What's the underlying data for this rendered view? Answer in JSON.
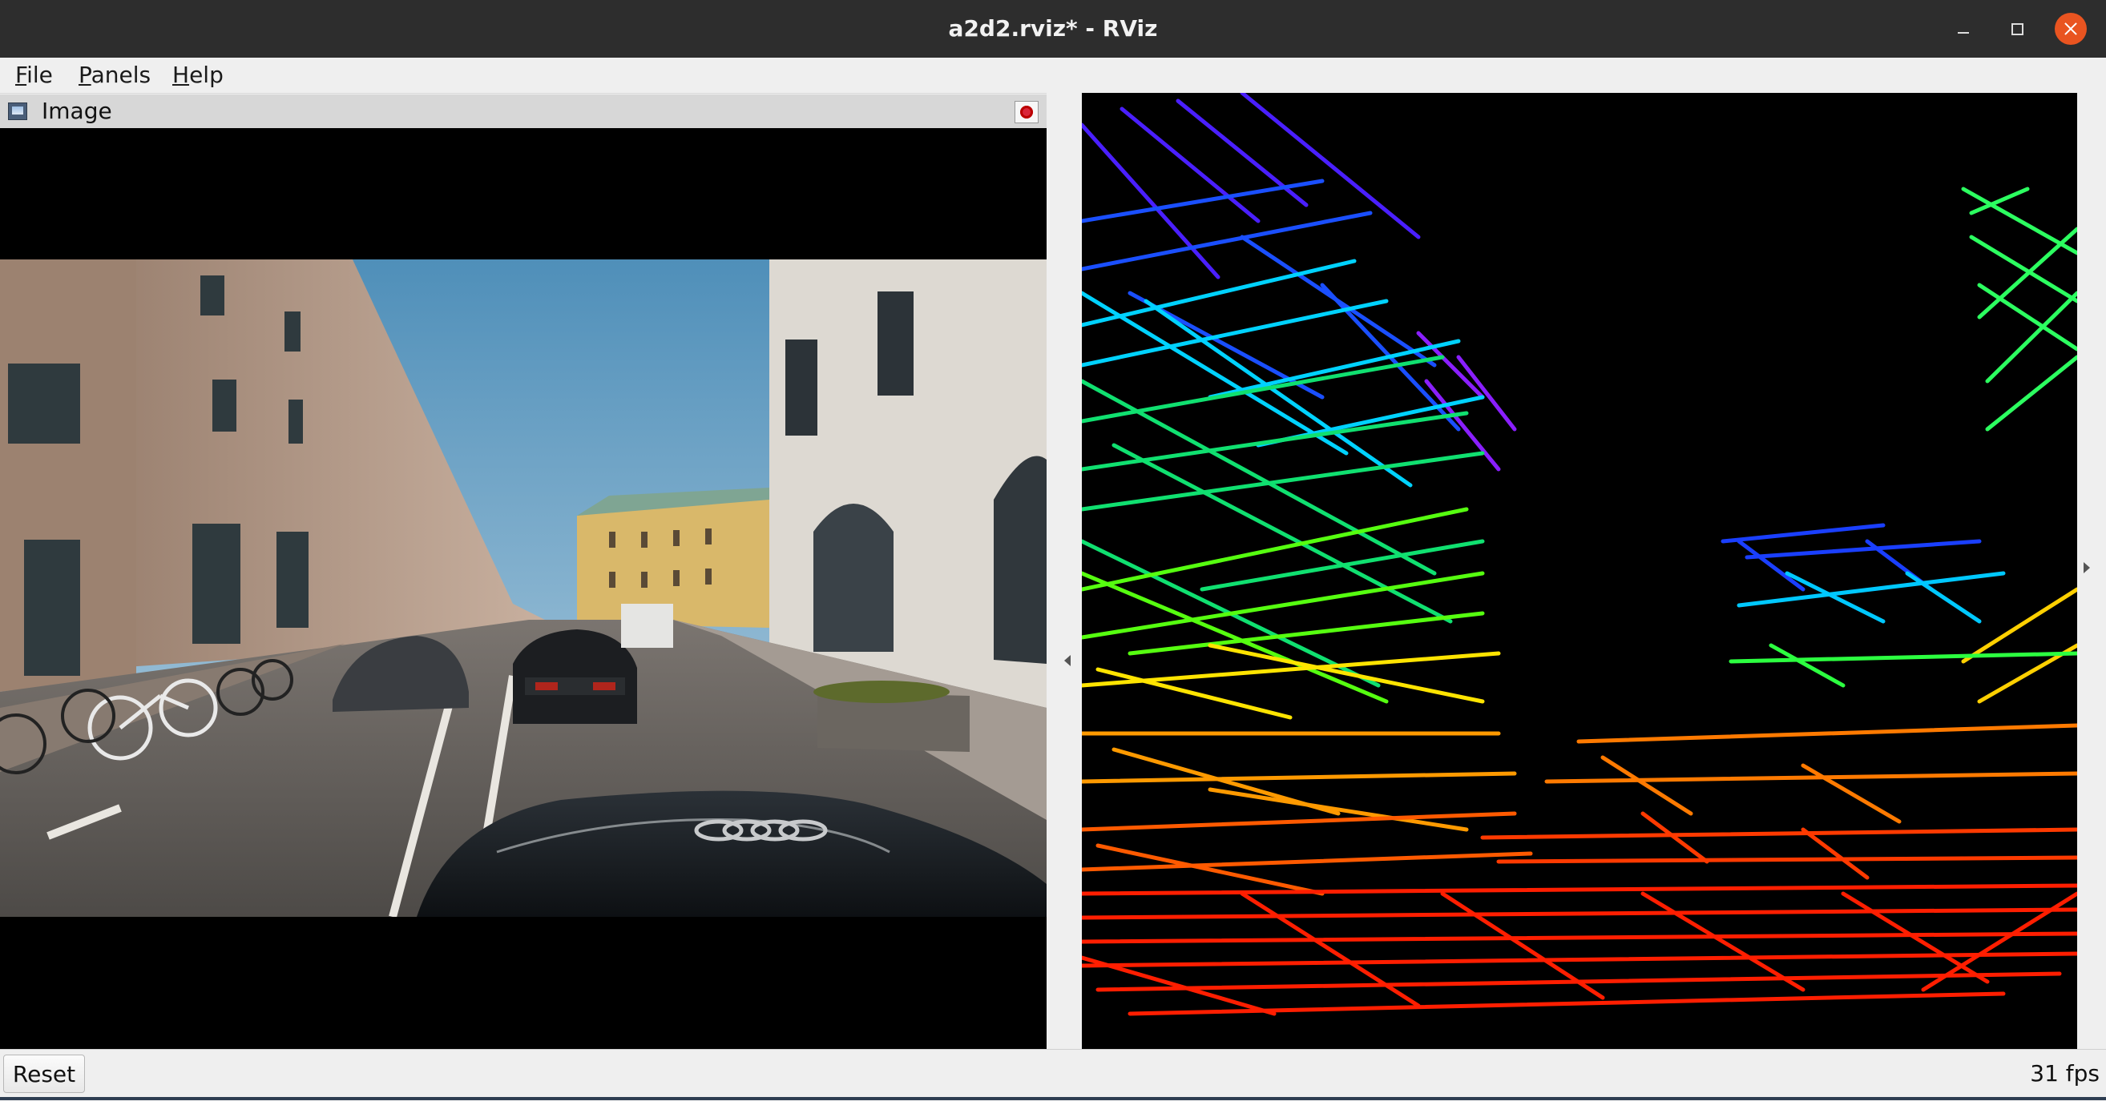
{
  "window": {
    "title": "a2d2.rviz* - RViz"
  },
  "menubar": {
    "items": [
      {
        "label": "File"
      },
      {
        "label": "Panels"
      },
      {
        "label": "Help"
      }
    ]
  },
  "image_panel": {
    "title": "Image",
    "icon": "image-icon",
    "close_icon": "close-icon"
  },
  "lidar_view": {
    "description_colors": [
      "#ff2000",
      "#ff7a00",
      "#ffe000",
      "#4cff00",
      "#00e0ff",
      "#0050ff",
      "#a000ff"
    ]
  },
  "statusbar": {
    "reset_label": "Reset",
    "fps": "31 fps"
  },
  "colors": {
    "titlebar": "#2d2d2d",
    "close_button": "#e95420",
    "background": "#efefef"
  }
}
